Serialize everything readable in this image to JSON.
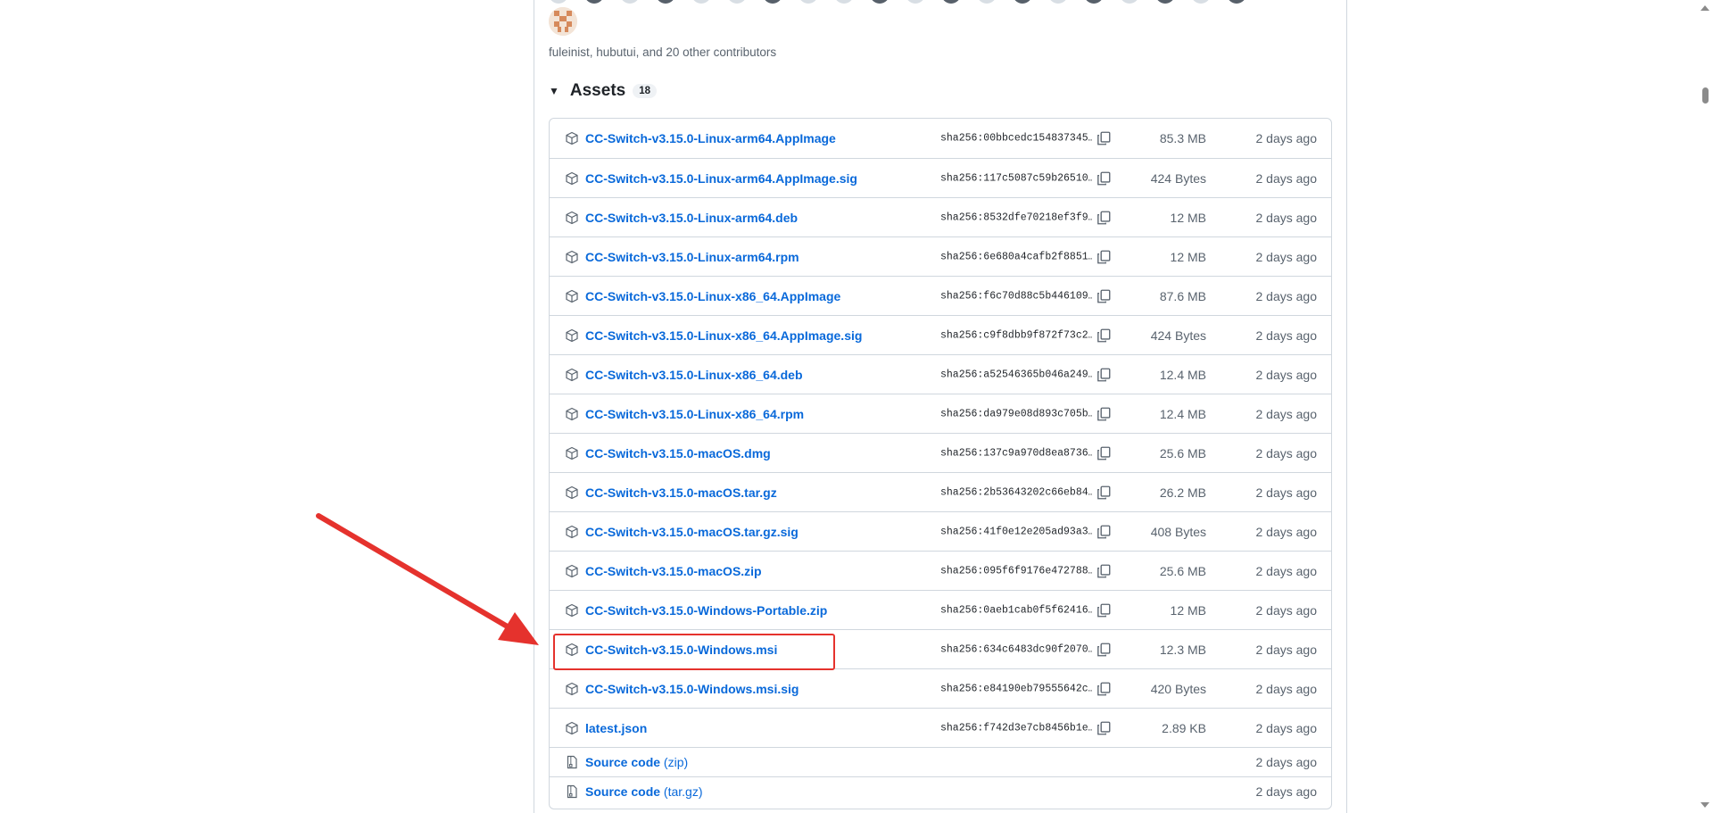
{
  "contributors_text": "fuleinist, hubutui, and 20 other contributors",
  "assets": {
    "title": "Assets",
    "count": "18",
    "items": [
      {
        "name": "CC-Switch-v3.15.0-Linux-arm64.AppImage",
        "sha": "sha256:00bbcedc154837345…",
        "size": "85.3 MB",
        "date": "2 days ago"
      },
      {
        "name": "CC-Switch-v3.15.0-Linux-arm64.AppImage.sig",
        "sha": "sha256:117c5087c59b26510…",
        "size": "424 Bytes",
        "date": "2 days ago"
      },
      {
        "name": "CC-Switch-v3.15.0-Linux-arm64.deb",
        "sha": "sha256:8532dfe70218ef3f9…",
        "size": "12 MB",
        "date": "2 days ago"
      },
      {
        "name": "CC-Switch-v3.15.0-Linux-arm64.rpm",
        "sha": "sha256:6e680a4cafb2f8851…",
        "size": "12 MB",
        "date": "2 days ago"
      },
      {
        "name": "CC-Switch-v3.15.0-Linux-x86_64.AppImage",
        "sha": "sha256:f6c70d88c5b446109…",
        "size": "87.6 MB",
        "date": "2 days ago"
      },
      {
        "name": "CC-Switch-v3.15.0-Linux-x86_64.AppImage.sig",
        "sha": "sha256:c9f8dbb9f872f73c2…",
        "size": "424 Bytes",
        "date": "2 days ago"
      },
      {
        "name": "CC-Switch-v3.15.0-Linux-x86_64.deb",
        "sha": "sha256:a52546365b046a249…",
        "size": "12.4 MB",
        "date": "2 days ago"
      },
      {
        "name": "CC-Switch-v3.15.0-Linux-x86_64.rpm",
        "sha": "sha256:da979e08d893c705b…",
        "size": "12.4 MB",
        "date": "2 days ago"
      },
      {
        "name": "CC-Switch-v3.15.0-macOS.dmg",
        "sha": "sha256:137c9a970d8ea8736…",
        "size": "25.6 MB",
        "date": "2 days ago"
      },
      {
        "name": "CC-Switch-v3.15.0-macOS.tar.gz",
        "sha": "sha256:2b53643202c66eb84…",
        "size": "26.2 MB",
        "date": "2 days ago"
      },
      {
        "name": "CC-Switch-v3.15.0-macOS.tar.gz.sig",
        "sha": "sha256:41f0e12e205ad93a3…",
        "size": "408 Bytes",
        "date": "2 days ago"
      },
      {
        "name": "CC-Switch-v3.15.0-macOS.zip",
        "sha": "sha256:095f6f9176e472788…",
        "size": "25.6 MB",
        "date": "2 days ago"
      },
      {
        "name": "CC-Switch-v3.15.0-Windows-Portable.zip",
        "sha": "sha256:0aeb1cab0f5f62416…",
        "size": "12 MB",
        "date": "2 days ago"
      },
      {
        "name": "CC-Switch-v3.15.0-Windows.msi",
        "sha": "sha256:634c6483dc90f2070…",
        "size": "12.3 MB",
        "date": "2 days ago"
      },
      {
        "name": "CC-Switch-v3.15.0-Windows.msi.sig",
        "sha": "sha256:e84190eb79555642c…",
        "size": "420 Bytes",
        "date": "2 days ago"
      },
      {
        "name": "latest.json",
        "sha": "sha256:f742d3e7cb8456b1e…",
        "size": "2.89 KB",
        "date": "2 days ago"
      }
    ],
    "source": [
      {
        "name": "Source code",
        "suffix": "(zip)",
        "date": "2 days ago"
      },
      {
        "name": "Source code",
        "suffix": "(tar.gz)",
        "date": "2 days ago"
      }
    ]
  },
  "icons": {
    "package": "package-icon",
    "file_zip": "file-zip-icon",
    "copy": "copy-icon",
    "caret": "triangle-down-icon"
  },
  "colors": {
    "link": "#0969da",
    "highlight": "#e5322d",
    "muted": "#59636e",
    "border": "#d0d7de"
  }
}
